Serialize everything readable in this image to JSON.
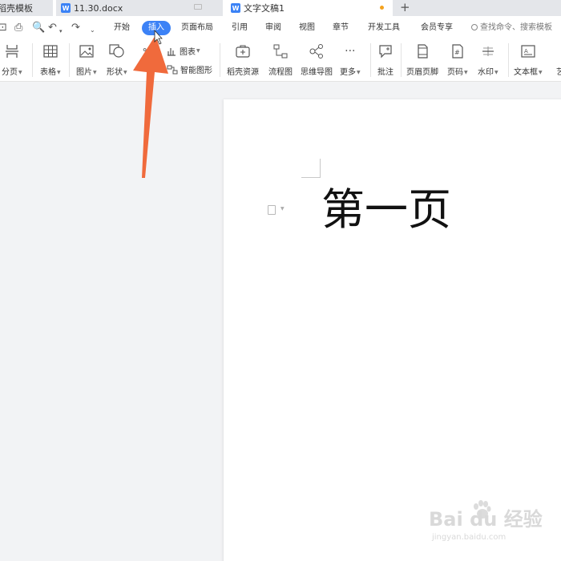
{
  "tabs": [
    {
      "label": "稻壳模板"
    },
    {
      "label": "11.30.docx"
    },
    {
      "label": "文字文稿1"
    }
  ],
  "menu": {
    "items": [
      "开始",
      "插入",
      "页面布局",
      "引用",
      "审阅",
      "视图",
      "章节",
      "开发工具",
      "会员专享"
    ],
    "active": "插入",
    "search_placeholder": "查找命令、搜索模板"
  },
  "ribbon": {
    "page_break": "分页",
    "table": "表格",
    "picture": "图片",
    "shape": "形状",
    "chart": "图表",
    "smart_graphic": "智能图形",
    "docer_resources": "稻壳资源",
    "flowchart": "流程图",
    "mindmap": "思维导图",
    "more": "更多",
    "comment": "批注",
    "header_footer": "页眉页脚",
    "page_number": "页码",
    "watermark": "水印",
    "textbox": "文本框",
    "art": "艺"
  },
  "document": {
    "text": "第一页"
  },
  "watermark": {
    "brand": "Bai du 经验",
    "url": "jingyan.baidu.com"
  },
  "colors": {
    "accent": "#3c82f6",
    "annotation_arrow": "#f06a3c",
    "unsaved_dot": "#f4a21e"
  }
}
